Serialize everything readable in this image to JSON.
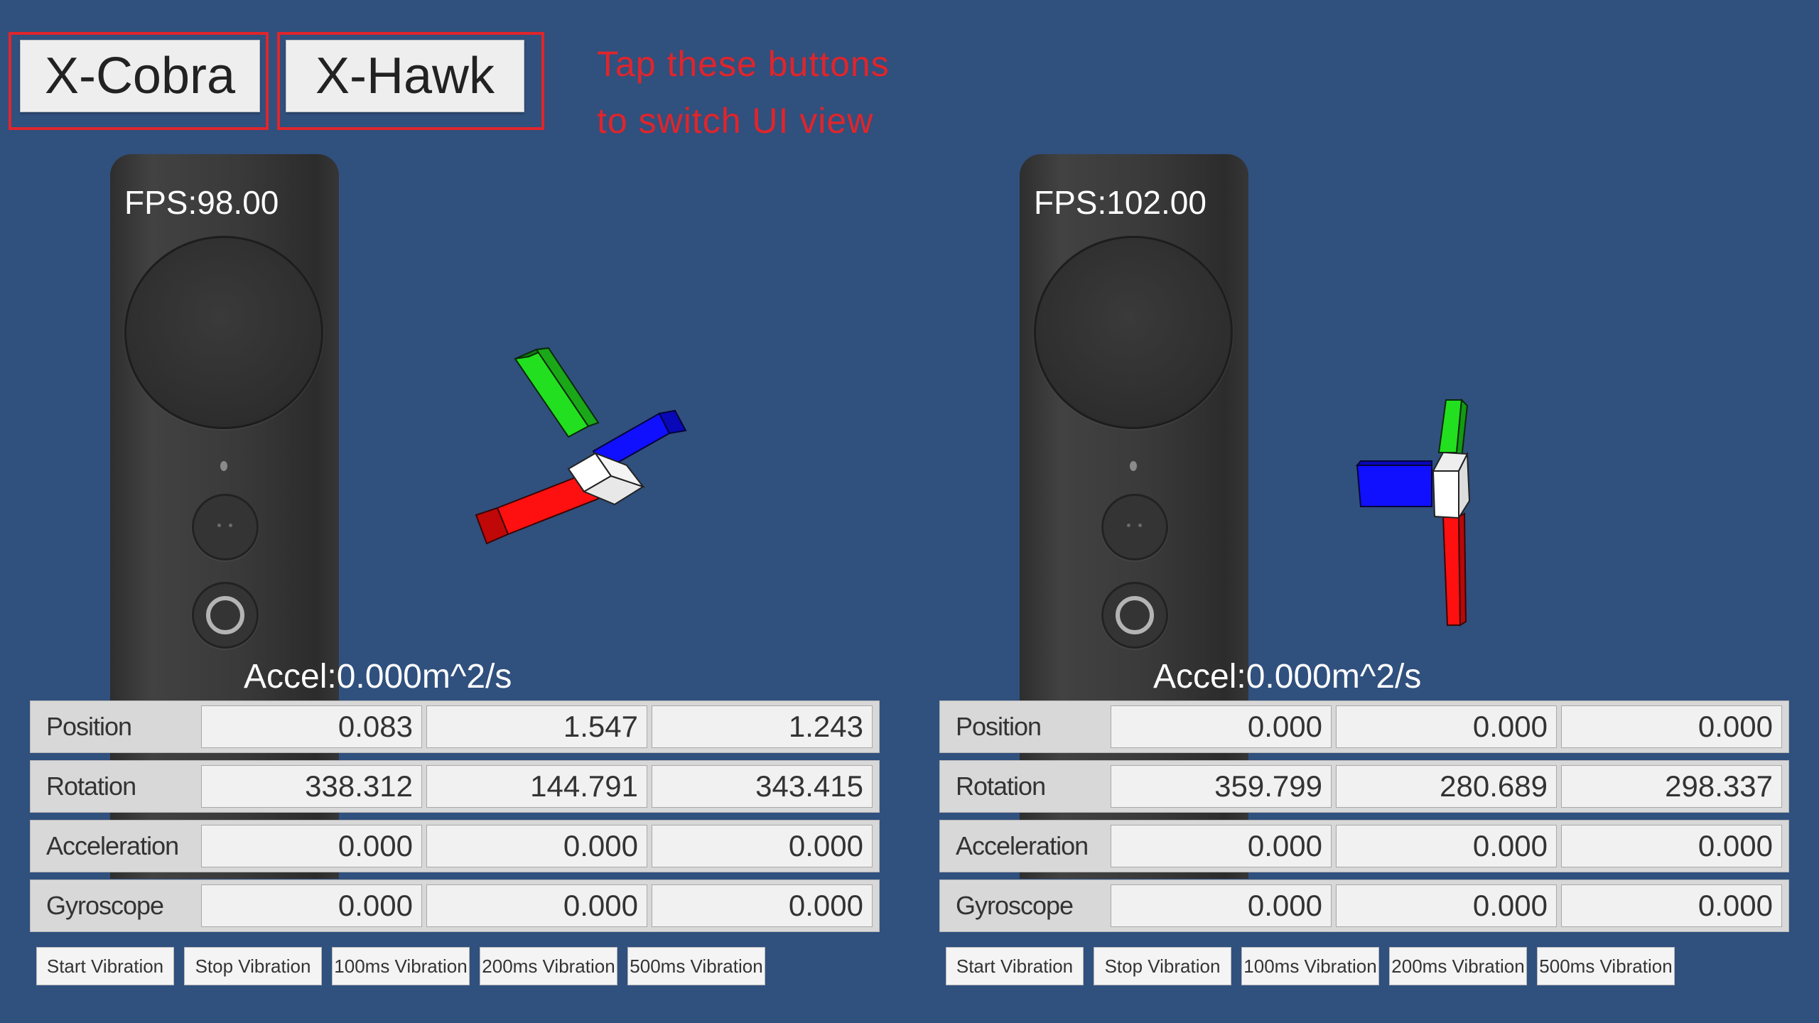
{
  "switch_buttons": [
    "X-Cobra",
    "X-Hawk"
  ],
  "hint_lines": [
    "Tap these buttons",
    "to switch UI view"
  ],
  "row_labels": [
    "Position",
    "Rotation",
    "Acceleration",
    "Gyroscope"
  ],
  "vibration_buttons": [
    "Start Vibration",
    "Stop Vibration",
    "100ms Vibration",
    "200ms Vibration",
    "500ms Vibration"
  ],
  "panels": [
    {
      "fps": "FPS:98.00",
      "accel": "Accel:0.000m^2/s",
      "rows": [
        [
          "0.083",
          "1.547",
          "1.243"
        ],
        [
          "338.312",
          "144.791",
          "343.415"
        ],
        [
          "0.000",
          "0.000",
          "0.000"
        ],
        [
          "0.000",
          "0.000",
          "0.000"
        ]
      ]
    },
    {
      "fps": "FPS:102.00",
      "accel": "Accel:0.000m^2/s",
      "rows": [
        [
          "0.000",
          "0.000",
          "0.000"
        ],
        [
          "359.799",
          "280.689",
          "298.337"
        ],
        [
          "0.000",
          "0.000",
          "0.000"
        ],
        [
          "0.000",
          "0.000",
          "0.000"
        ]
      ]
    }
  ],
  "axis_colors": {
    "x": "#ff1010",
    "y": "#22e01f",
    "z": "#1010ff",
    "center": "#ffffff"
  },
  "icons": [
    "controller-touchpad",
    "controller-app-button",
    "controller-home-button",
    "axis-gizmo"
  ]
}
